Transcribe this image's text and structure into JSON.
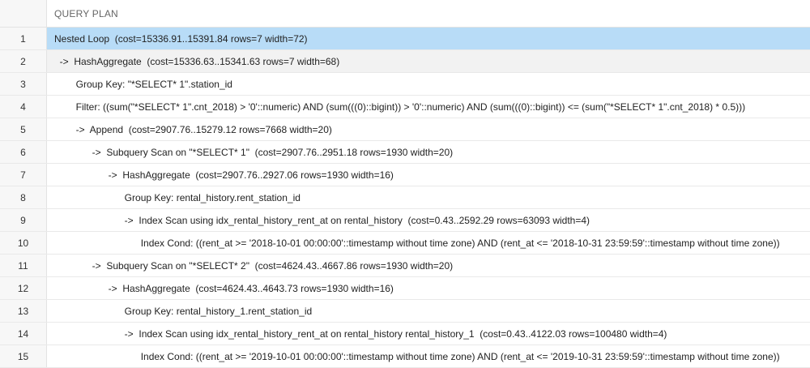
{
  "header": {
    "title": "QUERY PLAN"
  },
  "rows": [
    {
      "num": "1",
      "text": "Nested Loop  (cost=15336.91..15391.84 rows=7 width=72)"
    },
    {
      "num": "2",
      "text": "  ->  HashAggregate  (cost=15336.63..15341.63 rows=7 width=68)"
    },
    {
      "num": "3",
      "text": "        Group Key: \"*SELECT* 1\".station_id"
    },
    {
      "num": "4",
      "text": "        Filter: ((sum(\"*SELECT* 1\".cnt_2018) > '0'::numeric) AND (sum(((0)::bigint)) > '0'::numeric) AND (sum(((0)::bigint)) <= (sum(\"*SELECT* 1\".cnt_2018) * 0.5)))"
    },
    {
      "num": "5",
      "text": "        ->  Append  (cost=2907.76..15279.12 rows=7668 width=20)"
    },
    {
      "num": "6",
      "text": "              ->  Subquery Scan on \"*SELECT* 1\"  (cost=2907.76..2951.18 rows=1930 width=20)"
    },
    {
      "num": "7",
      "text": "                    ->  HashAggregate  (cost=2907.76..2927.06 rows=1930 width=16)"
    },
    {
      "num": "8",
      "text": "                          Group Key: rental_history.rent_station_id"
    },
    {
      "num": "9",
      "text": "                          ->  Index Scan using idx_rental_history_rent_at on rental_history  (cost=0.43..2592.29 rows=63093 width=4)"
    },
    {
      "num": "10",
      "text": "                                Index Cond: ((rent_at >= '2018-10-01 00:00:00'::timestamp without time zone) AND (rent_at <= '2018-10-31 23:59:59'::timestamp without time zone))"
    },
    {
      "num": "11",
      "text": "              ->  Subquery Scan on \"*SELECT* 2\"  (cost=4624.43..4667.86 rows=1930 width=20)"
    },
    {
      "num": "12",
      "text": "                    ->  HashAggregate  (cost=4624.43..4643.73 rows=1930 width=16)"
    },
    {
      "num": "13",
      "text": "                          Group Key: rental_history_1.rent_station_id"
    },
    {
      "num": "14",
      "text": "                          ->  Index Scan using idx_rental_history_rent_at on rental_history rental_history_1  (cost=0.43..4122.03 rows=100480 width=4)"
    },
    {
      "num": "15",
      "text": "                                Index Cond: ((rent_at >= '2019-10-01 00:00:00'::timestamp without time zone) AND (rent_at <= '2019-10-31 23:59:59'::timestamp without time zone))"
    }
  ]
}
